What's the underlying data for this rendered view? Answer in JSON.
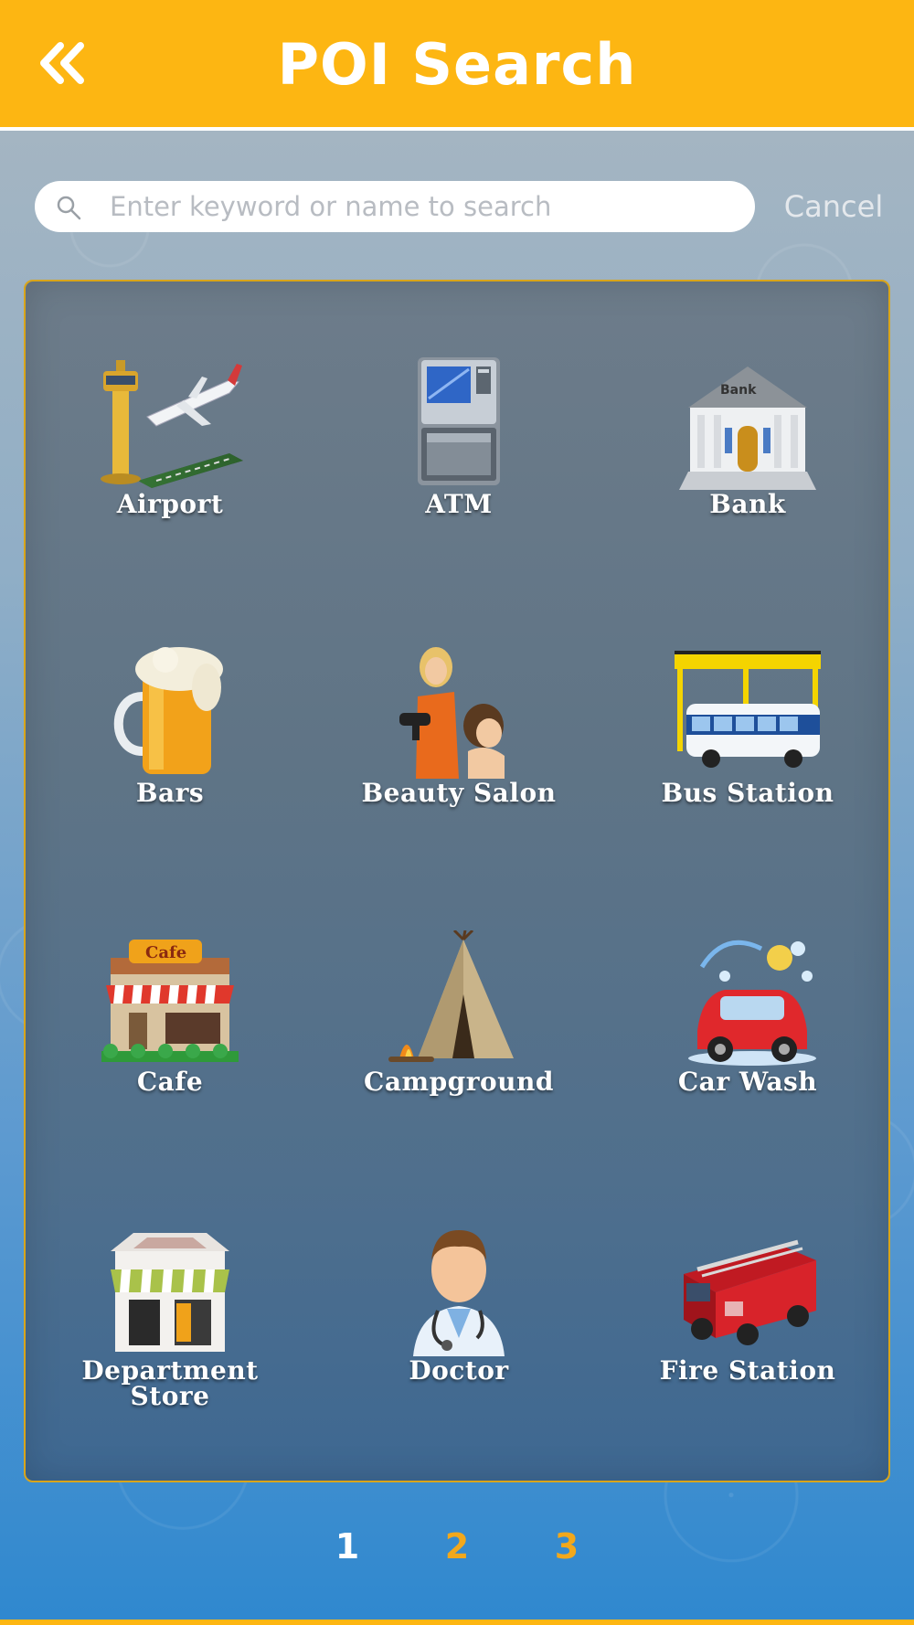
{
  "header": {
    "title": "POI Search",
    "back_icon": "double-chevron-left-icon"
  },
  "search": {
    "placeholder": "Enter keyword or name to search",
    "value": "",
    "cancel_label": "Cancel",
    "icon": "search-icon"
  },
  "categories": [
    {
      "label": "Airport",
      "icon": "airport-icon"
    },
    {
      "label": "ATM",
      "icon": "atm-icon"
    },
    {
      "label": "Bank",
      "icon": "bank-icon"
    },
    {
      "label": "Bars",
      "icon": "beer-mug-icon"
    },
    {
      "label": "Beauty Salon",
      "icon": "beauty-salon-icon"
    },
    {
      "label": "Bus Station",
      "icon": "bus-station-icon"
    },
    {
      "label": "Cafe",
      "icon": "cafe-icon"
    },
    {
      "label": "Campground",
      "icon": "tent-icon"
    },
    {
      "label": "Car Wash",
      "icon": "car-wash-icon"
    },
    {
      "label": "Department Store",
      "icon": "department-store-icon"
    },
    {
      "label": "Doctor",
      "icon": "doctor-icon"
    },
    {
      "label": "Fire Station",
      "icon": "fire-truck-icon"
    }
  ],
  "pagination": {
    "pages": [
      "1",
      "2",
      "3"
    ],
    "current": "1"
  },
  "colors": {
    "header": "#fdb612",
    "panel_border": "#d9a51a",
    "active_page": "#ffffff",
    "inactive_page": "#f2a81c"
  }
}
